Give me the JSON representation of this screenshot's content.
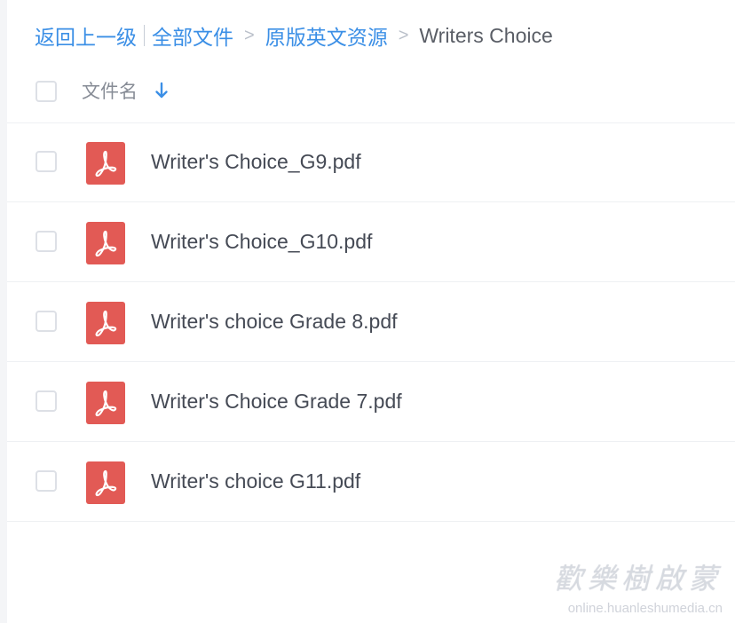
{
  "breadcrumb": {
    "back": "返回上一级",
    "all_files": "全部文件",
    "folder": "原版英文资源",
    "current": "Writers Choice",
    "separator": ">"
  },
  "header": {
    "name_column": "文件名",
    "sort_icon": "arrow-down-icon"
  },
  "files": [
    {
      "name": "Writer's Choice_G9.pdf",
      "icon": "pdf-icon"
    },
    {
      "name": "Writer's Choice_G10.pdf",
      "icon": "pdf-icon"
    },
    {
      "name": "Writer's choice Grade 8.pdf",
      "icon": "pdf-icon"
    },
    {
      "name": "Writer's Choice Grade 7.pdf",
      "icon": "pdf-icon"
    },
    {
      "name": "Writer's choice G11.pdf",
      "icon": "pdf-icon"
    }
  ],
  "watermark": {
    "title": "歡樂樹啟蒙",
    "url": "online.huanleshumedia.cn"
  },
  "colors": {
    "link": "#3b8fe6",
    "pdf_red": "#e25a55",
    "text": "#454a55",
    "muted": "#878c96"
  }
}
